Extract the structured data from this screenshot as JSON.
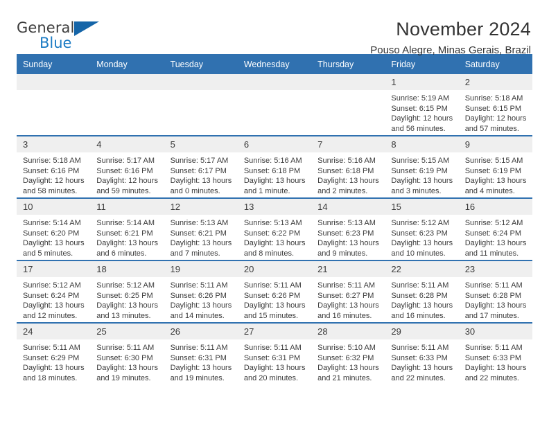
{
  "brand": {
    "name_part1": "General",
    "name_part2": "Blue",
    "flag_icon": "triangle-flag-icon"
  },
  "header": {
    "title": "November 2024",
    "subtitle": "Pouso Alegre, Minas Gerais, Brazil"
  },
  "colors": {
    "header_blue": "#3071b0",
    "brand_blue": "#1d7cc4",
    "daynum_band": "#efefef"
  },
  "weekdays": [
    "Sunday",
    "Monday",
    "Tuesday",
    "Wednesday",
    "Thursday",
    "Friday",
    "Saturday"
  ],
  "weeks": [
    [
      {
        "day": "",
        "sunrise": "",
        "sunset": "",
        "daylight": ""
      },
      {
        "day": "",
        "sunrise": "",
        "sunset": "",
        "daylight": ""
      },
      {
        "day": "",
        "sunrise": "",
        "sunset": "",
        "daylight": ""
      },
      {
        "day": "",
        "sunrise": "",
        "sunset": "",
        "daylight": ""
      },
      {
        "day": "",
        "sunrise": "",
        "sunset": "",
        "daylight": ""
      },
      {
        "day": "1",
        "sunrise": "Sunrise: 5:19 AM",
        "sunset": "Sunset: 6:15 PM",
        "daylight": "Daylight: 12 hours and 56 minutes."
      },
      {
        "day": "2",
        "sunrise": "Sunrise: 5:18 AM",
        "sunset": "Sunset: 6:15 PM",
        "daylight": "Daylight: 12 hours and 57 minutes."
      }
    ],
    [
      {
        "day": "3",
        "sunrise": "Sunrise: 5:18 AM",
        "sunset": "Sunset: 6:16 PM",
        "daylight": "Daylight: 12 hours and 58 minutes."
      },
      {
        "day": "4",
        "sunrise": "Sunrise: 5:17 AM",
        "sunset": "Sunset: 6:16 PM",
        "daylight": "Daylight: 12 hours and 59 minutes."
      },
      {
        "day": "5",
        "sunrise": "Sunrise: 5:17 AM",
        "sunset": "Sunset: 6:17 PM",
        "daylight": "Daylight: 13 hours and 0 minutes."
      },
      {
        "day": "6",
        "sunrise": "Sunrise: 5:16 AM",
        "sunset": "Sunset: 6:18 PM",
        "daylight": "Daylight: 13 hours and 1 minute."
      },
      {
        "day": "7",
        "sunrise": "Sunrise: 5:16 AM",
        "sunset": "Sunset: 6:18 PM",
        "daylight": "Daylight: 13 hours and 2 minutes."
      },
      {
        "day": "8",
        "sunrise": "Sunrise: 5:15 AM",
        "sunset": "Sunset: 6:19 PM",
        "daylight": "Daylight: 13 hours and 3 minutes."
      },
      {
        "day": "9",
        "sunrise": "Sunrise: 5:15 AM",
        "sunset": "Sunset: 6:19 PM",
        "daylight": "Daylight: 13 hours and 4 minutes."
      }
    ],
    [
      {
        "day": "10",
        "sunrise": "Sunrise: 5:14 AM",
        "sunset": "Sunset: 6:20 PM",
        "daylight": "Daylight: 13 hours and 5 minutes."
      },
      {
        "day": "11",
        "sunrise": "Sunrise: 5:14 AM",
        "sunset": "Sunset: 6:21 PM",
        "daylight": "Daylight: 13 hours and 6 minutes."
      },
      {
        "day": "12",
        "sunrise": "Sunrise: 5:13 AM",
        "sunset": "Sunset: 6:21 PM",
        "daylight": "Daylight: 13 hours and 7 minutes."
      },
      {
        "day": "13",
        "sunrise": "Sunrise: 5:13 AM",
        "sunset": "Sunset: 6:22 PM",
        "daylight": "Daylight: 13 hours and 8 minutes."
      },
      {
        "day": "14",
        "sunrise": "Sunrise: 5:13 AM",
        "sunset": "Sunset: 6:23 PM",
        "daylight": "Daylight: 13 hours and 9 minutes."
      },
      {
        "day": "15",
        "sunrise": "Sunrise: 5:12 AM",
        "sunset": "Sunset: 6:23 PM",
        "daylight": "Daylight: 13 hours and 10 minutes."
      },
      {
        "day": "16",
        "sunrise": "Sunrise: 5:12 AM",
        "sunset": "Sunset: 6:24 PM",
        "daylight": "Daylight: 13 hours and 11 minutes."
      }
    ],
    [
      {
        "day": "17",
        "sunrise": "Sunrise: 5:12 AM",
        "sunset": "Sunset: 6:24 PM",
        "daylight": "Daylight: 13 hours and 12 minutes."
      },
      {
        "day": "18",
        "sunrise": "Sunrise: 5:12 AM",
        "sunset": "Sunset: 6:25 PM",
        "daylight": "Daylight: 13 hours and 13 minutes."
      },
      {
        "day": "19",
        "sunrise": "Sunrise: 5:11 AM",
        "sunset": "Sunset: 6:26 PM",
        "daylight": "Daylight: 13 hours and 14 minutes."
      },
      {
        "day": "20",
        "sunrise": "Sunrise: 5:11 AM",
        "sunset": "Sunset: 6:26 PM",
        "daylight": "Daylight: 13 hours and 15 minutes."
      },
      {
        "day": "21",
        "sunrise": "Sunrise: 5:11 AM",
        "sunset": "Sunset: 6:27 PM",
        "daylight": "Daylight: 13 hours and 16 minutes."
      },
      {
        "day": "22",
        "sunrise": "Sunrise: 5:11 AM",
        "sunset": "Sunset: 6:28 PM",
        "daylight": "Daylight: 13 hours and 16 minutes."
      },
      {
        "day": "23",
        "sunrise": "Sunrise: 5:11 AM",
        "sunset": "Sunset: 6:28 PM",
        "daylight": "Daylight: 13 hours and 17 minutes."
      }
    ],
    [
      {
        "day": "24",
        "sunrise": "Sunrise: 5:11 AM",
        "sunset": "Sunset: 6:29 PM",
        "daylight": "Daylight: 13 hours and 18 minutes."
      },
      {
        "day": "25",
        "sunrise": "Sunrise: 5:11 AM",
        "sunset": "Sunset: 6:30 PM",
        "daylight": "Daylight: 13 hours and 19 minutes."
      },
      {
        "day": "26",
        "sunrise": "Sunrise: 5:11 AM",
        "sunset": "Sunset: 6:31 PM",
        "daylight": "Daylight: 13 hours and 19 minutes."
      },
      {
        "day": "27",
        "sunrise": "Sunrise: 5:11 AM",
        "sunset": "Sunset: 6:31 PM",
        "daylight": "Daylight: 13 hours and 20 minutes."
      },
      {
        "day": "28",
        "sunrise": "Sunrise: 5:10 AM",
        "sunset": "Sunset: 6:32 PM",
        "daylight": "Daylight: 13 hours and 21 minutes."
      },
      {
        "day": "29",
        "sunrise": "Sunrise: 5:11 AM",
        "sunset": "Sunset: 6:33 PM",
        "daylight": "Daylight: 13 hours and 22 minutes."
      },
      {
        "day": "30",
        "sunrise": "Sunrise: 5:11 AM",
        "sunset": "Sunset: 6:33 PM",
        "daylight": "Daylight: 13 hours and 22 minutes."
      }
    ]
  ]
}
